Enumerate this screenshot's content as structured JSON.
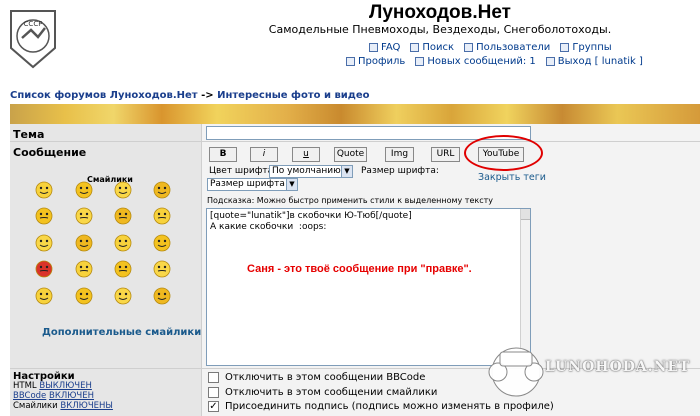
{
  "header": {
    "site_title": "Луноходов.Нет",
    "site_subtitle": "Самодельные Пневмоходы, Вездеходы, Снегоболотоходы.",
    "logo_text": "СССР",
    "nav_row1": [
      {
        "label": "FAQ",
        "icon": "faq-icon"
      },
      {
        "label": "Поиск",
        "icon": "search-icon"
      },
      {
        "label": "Пользователи",
        "icon": "users-icon"
      },
      {
        "label": "Группы",
        "icon": "groups-icon"
      }
    ],
    "nav_row2": [
      {
        "label": "Профиль",
        "icon": "profile-icon"
      },
      {
        "label": "Новых сообщений: 1",
        "icon": "messages-icon"
      },
      {
        "label": "Выход [ lunatik ]",
        "icon": "logout-icon"
      }
    ]
  },
  "breadcrumb": {
    "forum_index": "Список форумов Луноходов.Нет",
    "separator": "->",
    "current": "Интересные фото и видео"
  },
  "form": {
    "subject_label": "Тема",
    "subject_value": "",
    "message_label": "Сообщение",
    "smilies_title": "Смайлики",
    "more_smilies": "Дополнительные смайлики",
    "bbcode_buttons": [
      "B",
      "i",
      "u",
      "Quote",
      "Img",
      "URL",
      "YouTube"
    ],
    "font_color_label": "Цвет шрифта:",
    "font_color_value": "По умолчанию",
    "font_size_label": "Размер шрифта:",
    "font_size_value": "Размер шрифта",
    "close_tags": "Закрыть теги",
    "hint": "Подсказка: Можно быстро применить стили к выделенному тексту",
    "message_lines": [
      "[quote=\"lunatik\"]в скобочки Ю-Тюб[/quote]",
      "А какие скобочки  :oops:"
    ],
    "annotation": "Саня  - это твоё сообщение при \"правке\"."
  },
  "settings": {
    "title": "Настройки",
    "html_label": "HTML",
    "html_state": "ВЫКЛЮЧЕН",
    "bbcode_label": "BBCode",
    "bbcode_state": "ВКЛЮЧЕН",
    "smilies_label": "Смайлики",
    "smilies_state": "ВКЛЮЧЕНЫ",
    "options": [
      {
        "label": "Отключить в этом сообщении BBCode",
        "checked": false
      },
      {
        "label": "Отключить в этом сообщении смайлики",
        "checked": false
      },
      {
        "label": "Присоединить подпись (подпись можно изменять в профиле)",
        "checked": true
      }
    ]
  },
  "watermark": "LUNOHODA.NET",
  "colors": {
    "link": "#1a3e8c",
    "annotation": "#e60000",
    "highlight_circle": "#e00000"
  }
}
